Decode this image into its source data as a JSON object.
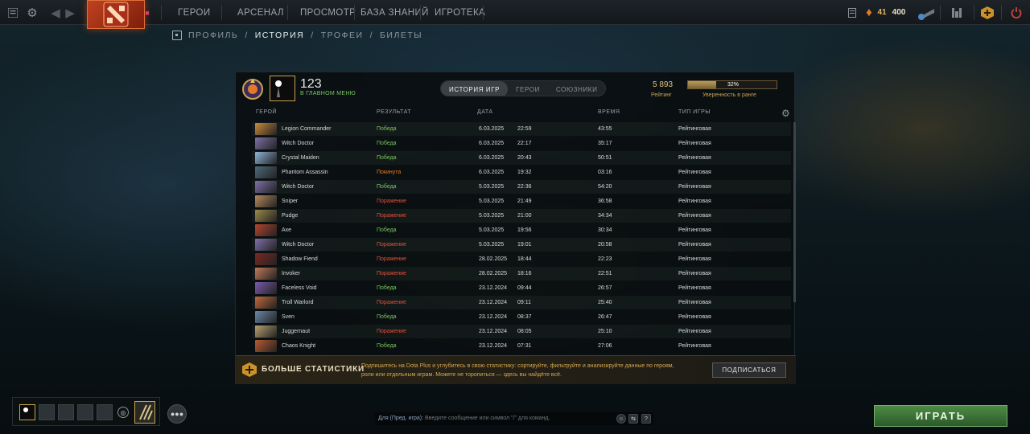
{
  "nav": {
    "items": [
      "ГЕРОИ",
      "АРСЕНАЛ",
      "ПРОСМОТР",
      "БАЗА ЗНАНИЙ",
      "ИГРОТЕКА"
    ],
    "currency_shards": "41",
    "currency_other": "400"
  },
  "subnav": {
    "items": [
      "ПРОФИЛЬ",
      "ИСТОРИЯ",
      "ТРОФЕИ",
      "БИЛЕТЫ"
    ],
    "separator": "/",
    "active_index": 1
  },
  "profile": {
    "name": "123",
    "status": "В ГЛАВНОМ МЕНЮ",
    "rating_value": "5 893",
    "rating_label": "Рейтинг",
    "confidence_percent": 32,
    "confidence_text": "32%",
    "confidence_label": "Уверенность в ранге"
  },
  "tabs": [
    "ИСТОРИЯ ИГР",
    "ГЕРОИ",
    "СОЮЗНИКИ"
  ],
  "columns": {
    "hero": "ГЕРОЙ",
    "result": "РЕЗУЛЬТАТ",
    "date": "ДАТА",
    "duration": "ВРЕМЯ",
    "type": "ТИП ИГРЫ"
  },
  "matches": [
    {
      "hero": "Legion Commander",
      "result": "Победа",
      "res": "win",
      "date": "6.03.2025",
      "time": "22:59",
      "duration": "43:55",
      "type": "Рейтинговая",
      "color": "#c98a3c"
    },
    {
      "hero": "Witch Doctor",
      "result": "Победа",
      "res": "win",
      "date": "6.03.2025",
      "time": "22:17",
      "duration": "35:17",
      "type": "Рейтинговая",
      "color": "#7f6fa6"
    },
    {
      "hero": "Crystal Maiden",
      "result": "Победа",
      "res": "win",
      "date": "6.03.2025",
      "time": "20:43",
      "duration": "50:51",
      "type": "Рейтинговая",
      "color": "#8fb4d8"
    },
    {
      "hero": "Phantom Assassin",
      "result": "Покинута",
      "res": "left",
      "date": "6.03.2025",
      "time": "19:32",
      "duration": "03:16",
      "type": "Рейтинговая",
      "color": "#4d6a78"
    },
    {
      "hero": "Witch Doctor",
      "result": "Победа",
      "res": "win",
      "date": "5.03.2025",
      "time": "22:36",
      "duration": "54:20",
      "type": "Рейтинговая",
      "color": "#7f6fa6"
    },
    {
      "hero": "Sniper",
      "result": "Поражение",
      "res": "loss",
      "date": "5.03.2025",
      "time": "21:49",
      "duration": "36:58",
      "type": "Рейтинговая",
      "color": "#b38a5a"
    },
    {
      "hero": "Pudge",
      "result": "Поражение",
      "res": "loss",
      "date": "5.03.2025",
      "time": "21:00",
      "duration": "34:34",
      "type": "Рейтинговая",
      "color": "#9a8a4a"
    },
    {
      "hero": "Axe",
      "result": "Победа",
      "res": "win",
      "date": "5.03.2025",
      "time": "19:56",
      "duration": "30:34",
      "type": "Рейтинговая",
      "color": "#b3442c"
    },
    {
      "hero": "Witch Doctor",
      "result": "Поражение",
      "res": "loss",
      "date": "5.03.2025",
      "time": "19:01",
      "duration": "20:58",
      "type": "Рейтинговая",
      "color": "#7f6fa6"
    },
    {
      "hero": "Shadow Fiend",
      "result": "Поражение",
      "res": "loss",
      "date": "28.02.2025",
      "time": "18:44",
      "duration": "22:23",
      "type": "Рейтинговая",
      "color": "#7a2a22"
    },
    {
      "hero": "Invoker",
      "result": "Поражение",
      "res": "loss",
      "date": "28.02.2025",
      "time": "18:16",
      "duration": "22:51",
      "type": "Рейтинговая",
      "color": "#c07a58"
    },
    {
      "hero": "Faceless Void",
      "result": "Победа",
      "res": "win",
      "date": "23.12.2024",
      "time": "09:44",
      "duration": "26:57",
      "type": "Рейтинговая",
      "color": "#7a5aa8"
    },
    {
      "hero": "Troll Warlord",
      "result": "Поражение",
      "res": "loss",
      "date": "23.12.2024",
      "time": "09:11",
      "duration": "25:40",
      "type": "Рейтинговая",
      "color": "#c0683a"
    },
    {
      "hero": "Sven",
      "result": "Победа",
      "res": "win",
      "date": "23.12.2024",
      "time": "08:37",
      "duration": "26:47",
      "type": "Рейтинговая",
      "color": "#6a88a8"
    },
    {
      "hero": "Juggernaut",
      "result": "Поражение",
      "res": "loss",
      "date": "23.12.2024",
      "time": "08:05",
      "duration": "25:10",
      "type": "Рейтинговая",
      "color": "#b8a070"
    },
    {
      "hero": "Chaos Knight",
      "result": "Победа",
      "res": "win",
      "date": "23.12.2024",
      "time": "07:31",
      "duration": "27:06",
      "type": "Рейтинговая",
      "color": "#b85a30"
    }
  ],
  "plus": {
    "title": "БОЛЬШЕ СТАТИСТИКИ",
    "text": "Подпишитесь на Dota Plus и углубитесь в свою статистику: сортируйте, фильтруйте и анализируйте данные по героям, роли или отдельным играм. Можете не торопиться — здесь вы найдёте всё.",
    "button": "ПОДПИСАТЬСЯ"
  },
  "chat": {
    "target": "Для (Пред. игра):",
    "placeholder": "Введите сообщение или символ \"/\" для команд."
  },
  "play_button": "ИГРАТЬ"
}
